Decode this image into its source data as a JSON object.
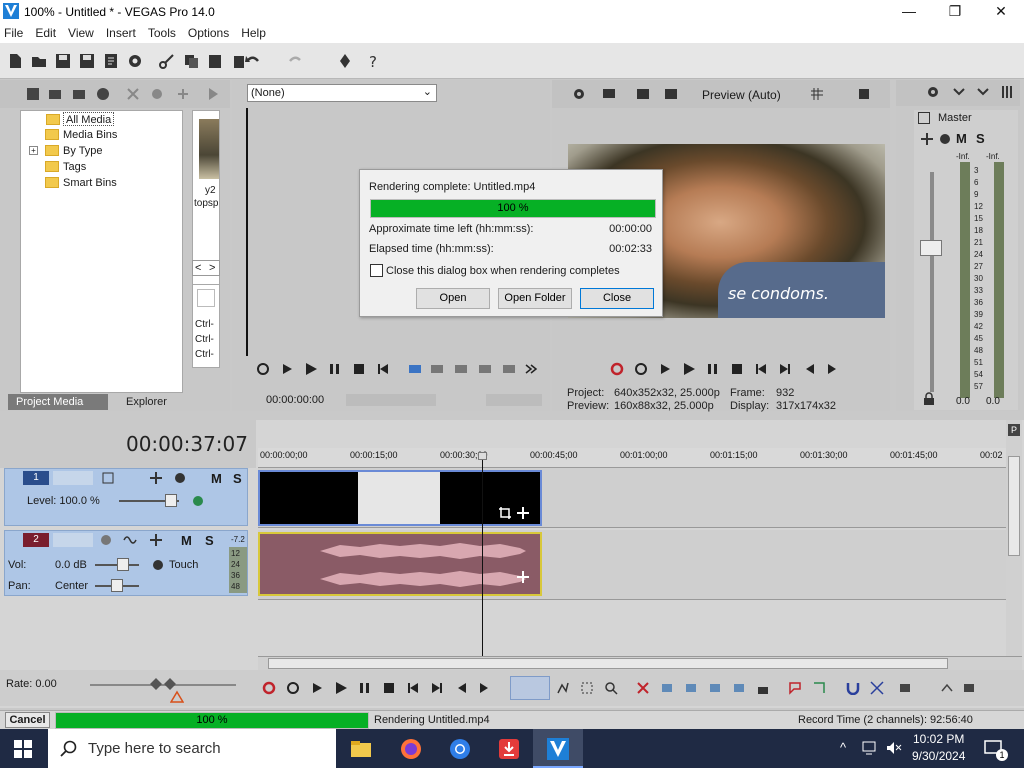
{
  "window": {
    "title": "100% - Untitled * - VEGAS Pro 14.0",
    "minimize": "—",
    "maximize": "❐",
    "close": "✕"
  },
  "menu": [
    "File",
    "Edit",
    "View",
    "Insert",
    "Tools",
    "Options",
    "Help"
  ],
  "project_media": {
    "tree": [
      "All Media",
      "Media Bins",
      "By Type",
      "Tags",
      "Smart Bins"
    ],
    "thumb_caption_1": "y2",
    "thumb_caption_2": "topsp",
    "nav_left": "<",
    "nav_right": ">",
    "ctrl_labels": [
      "Ctrl-",
      "Ctrl-",
      "Ctrl-"
    ],
    "tabs": [
      "Project Media",
      "Explorer"
    ]
  },
  "trimmer": {
    "preset": "(None)",
    "timecode": "00:00:00:00"
  },
  "preview": {
    "mode": "Preview (Auto)",
    "subtitle": "se condoms.",
    "project_label": "Project:",
    "project_value": "640x352x32, 25.000p",
    "frame_label": "Frame:",
    "frame_value": "932",
    "preview_label": "Preview:",
    "preview_value": "160x88x32, 25.000p",
    "display_label": "Display:",
    "display_value": "317x174x32"
  },
  "master": {
    "title": "Master",
    "mute": "M",
    "solo": "S",
    "inf_left": "-Inf.",
    "inf_right": "-Inf.",
    "scale": [
      "3",
      "6",
      "9",
      "12",
      "15",
      "18",
      "21",
      "24",
      "27",
      "30",
      "33",
      "36",
      "39",
      "42",
      "45",
      "48",
      "51",
      "54",
      "57"
    ],
    "bottom_left": "0.0",
    "bottom_right": "0.0"
  },
  "dialog": {
    "title": "Rendering complete: Untitled.mp4",
    "progress": 1.0,
    "progress_text": "100 %",
    "time_left_label": "Approximate time left (hh:mm:ss):",
    "time_left_value": "00:00:00",
    "elapsed_label": "Elapsed time (hh:mm:ss):",
    "elapsed_value": "00:02:33",
    "checkbox_label": "Close this dialog box when rendering completes",
    "checkbox_checked": false,
    "open": "Open",
    "open_folder": "Open Folder",
    "close": "Close"
  },
  "timeline": {
    "timecode": "00:00:37:07",
    "ruler": [
      "00:00:00;00",
      "00:00:15;00",
      "00:00:30;00",
      "00:00:45;00",
      "00:01:00;00",
      "00:01:15;00",
      "00:01:30;00",
      "00:01:45;00",
      "00:02"
    ],
    "track1": {
      "number": "1",
      "mute": "M",
      "solo": "S",
      "level": "Level: 100.0 %"
    },
    "track2": {
      "number": "2",
      "mute": "M",
      "solo": "S",
      "vol_label": "Vol:",
      "vol_value": "0.0 dB",
      "pan_label": "Pan:",
      "pan_value": "Center",
      "automation": "Touch",
      "peak": "-7.2",
      "meter_scale": [
        "12",
        "24",
        "36",
        "48"
      ]
    },
    "rate": "Rate: 0.00"
  },
  "statusbar": {
    "cancel": "Cancel",
    "progress": 1.0,
    "progress_text": "100 %",
    "rendering": "Rendering Untitled.mp4",
    "record_time": "Record Time (2 channels): 92:56:40"
  },
  "taskbar": {
    "search_placeholder": "Type here to search",
    "time": "10:02 PM",
    "date": "9/30/2024",
    "notif_count": "1"
  },
  "colors": {
    "progress_green": "#06b025",
    "track_blue": "#aec6e6",
    "audio_clip": "#8a5b66",
    "clip_border_audio": "#d8c83a",
    "clip_border_video": "#6a8ad6"
  }
}
